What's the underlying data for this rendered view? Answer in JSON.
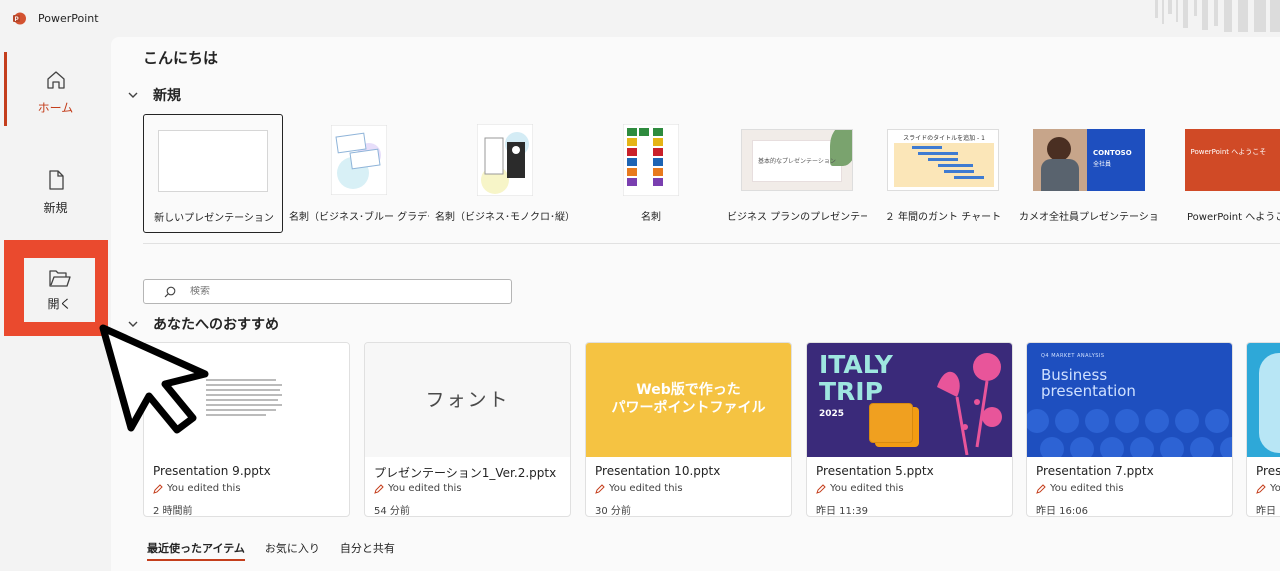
{
  "app": {
    "title": "PowerPoint"
  },
  "nav": {
    "home": "ホーム",
    "new": "新規",
    "open": "開く"
  },
  "greeting": "こんにちは",
  "new_section": {
    "title": "新規",
    "templates": [
      {
        "name": "新しいプレゼンテーション"
      },
      {
        "name": "名刺（ビジネス･ブルー グラデー…"
      },
      {
        "name": "名刺（ビジネス･モノクロ･縦）"
      },
      {
        "name": "名刺"
      },
      {
        "name": "ビジネス プランのプレゼンテーシ…",
        "thumb_text": "基本的なプレゼンテーション"
      },
      {
        "name": "２ 年間のガント チャート",
        "thumb_text": "スライドのタイトルを追加 - 1"
      },
      {
        "name": "カメオ全社員プレゼンテーション",
        "thumb_text": "CONTOSO",
        "thumb_sub": "全社員"
      },
      {
        "name": "PowerPoint へようこそ",
        "thumb_text": "PowerPoint へようこそ"
      }
    ]
  },
  "search": {
    "placeholder": "検索"
  },
  "recommended": {
    "title": "あなたへのおすすめ",
    "files": [
      {
        "name": "Presentation 9.pptx",
        "edited": "You edited this",
        "time": "2 時間前"
      },
      {
        "name": "プレゼンテーション1_Ver.2.pptx",
        "edited": "You edited this",
        "time": "54 分前",
        "thumb_text": "フォント"
      },
      {
        "name": "Presentation 10.pptx",
        "edited": "You edited this",
        "time": "30 分前",
        "thumb_line1": "Web版で作った",
        "thumb_line2": "パワーポイントファイル"
      },
      {
        "name": "Presentation 5.pptx",
        "edited": "You edited this",
        "time": "昨日 11:39",
        "thumb_line1": "ITALY",
        "thumb_line2": "TRIP",
        "thumb_line3": "2025"
      },
      {
        "name": "Presentation 7.pptx",
        "edited": "You edited this",
        "time": "昨日 16:06",
        "thumb_small": "Q4 MARKET ANALYSIS",
        "thumb_line1": "Business",
        "thumb_line2": "presentation"
      },
      {
        "name": "Pres",
        "edited": "Yo",
        "time": "昨日"
      }
    ]
  },
  "tabs": [
    "最近使ったアイテム",
    "お気に入り",
    "自分と共有"
  ],
  "colors": {
    "accent": "#c43e1c",
    "highlight": "#ea4a2e",
    "italy_bg": "#3a2a7a",
    "business_bg": "#1e4fbf",
    "webban_bg": "#f5c342"
  }
}
